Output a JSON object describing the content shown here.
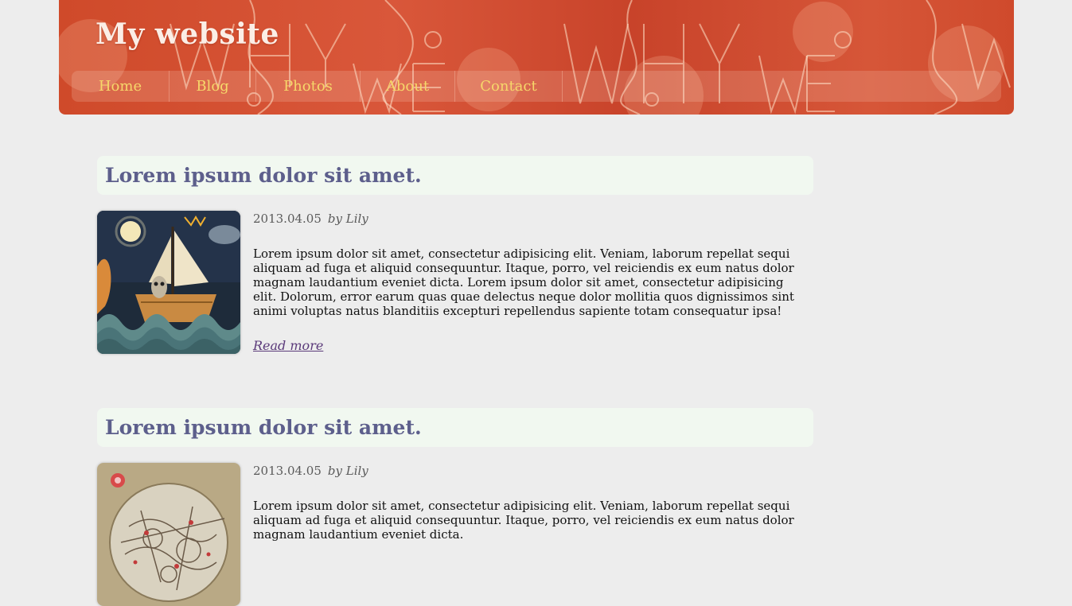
{
  "site": {
    "title": "My website"
  },
  "nav": {
    "items": [
      {
        "label": "Home"
      },
      {
        "label": "Blog"
      },
      {
        "label": "Photos"
      },
      {
        "label": "About"
      },
      {
        "label": "Contact"
      }
    ]
  },
  "posts": [
    {
      "title": "Lorem ipsum dolor sit amet.",
      "date": "2013.04.05",
      "author": "by Lily",
      "excerpt": "Lorem ipsum dolor sit amet, consectetur adipisicing elit. Veniam, laborum repellat sequi aliquam ad fuga et aliquid consequuntur. Itaque, porro, vel reiciendis ex eum natus dolor magnam laudantium eveniet dicta. Lorem ipsum dolor sit amet, consectetur adipisicing elit. Dolorum, error earum quas quae delectus neque dolor mollitia quos dignissimos sint animi voluptas natus blanditiis excepturi repellendus sapiente totam consequatur ipsa!",
      "read_more": "Read more"
    },
    {
      "title": "Lorem ipsum dolor sit amet.",
      "date": "2013.04.05",
      "author": "by Lily",
      "excerpt": "Lorem ipsum dolor sit amet, consectetur adipisicing elit. Veniam, laborum repellat sequi aliquam ad fuga et aliquid consequuntur. Itaque, porro, vel reiciendis ex eum natus dolor magnam laudantium eveniet dicta."
    }
  ],
  "colors": {
    "header": "#cf4a2a",
    "nav_text": "#f6d76a",
    "post_title": "#5d5f8c",
    "title_bar": "#f1f8f0",
    "page_bg": "#ededed",
    "link": "#5b3a7a"
  }
}
